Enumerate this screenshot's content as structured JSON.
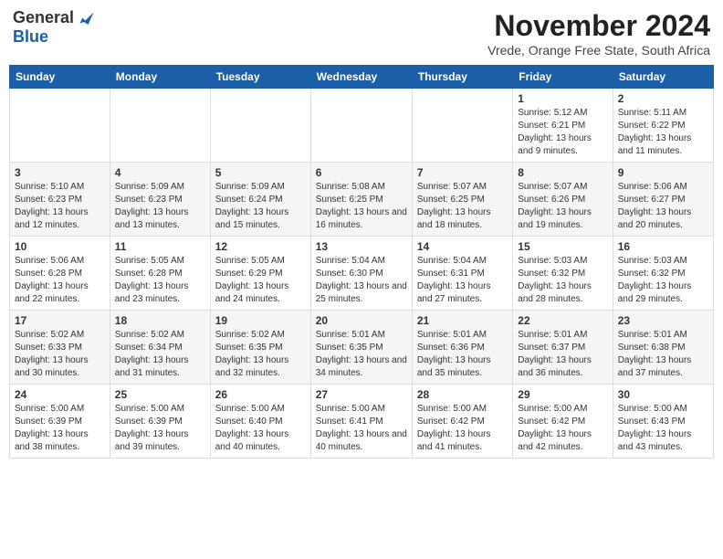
{
  "header": {
    "logo_general": "General",
    "logo_blue": "Blue",
    "month_title": "November 2024",
    "location": "Vrede, Orange Free State, South Africa"
  },
  "days_of_week": [
    "Sunday",
    "Monday",
    "Tuesday",
    "Wednesday",
    "Thursday",
    "Friday",
    "Saturday"
  ],
  "weeks": [
    [
      {
        "day": "",
        "info": ""
      },
      {
        "day": "",
        "info": ""
      },
      {
        "day": "",
        "info": ""
      },
      {
        "day": "",
        "info": ""
      },
      {
        "day": "",
        "info": ""
      },
      {
        "day": "1",
        "info": "Sunrise: 5:12 AM\nSunset: 6:21 PM\nDaylight: 13 hours and 9 minutes."
      },
      {
        "day": "2",
        "info": "Sunrise: 5:11 AM\nSunset: 6:22 PM\nDaylight: 13 hours and 11 minutes."
      }
    ],
    [
      {
        "day": "3",
        "info": "Sunrise: 5:10 AM\nSunset: 6:23 PM\nDaylight: 13 hours and 12 minutes."
      },
      {
        "day": "4",
        "info": "Sunrise: 5:09 AM\nSunset: 6:23 PM\nDaylight: 13 hours and 13 minutes."
      },
      {
        "day": "5",
        "info": "Sunrise: 5:09 AM\nSunset: 6:24 PM\nDaylight: 13 hours and 15 minutes."
      },
      {
        "day": "6",
        "info": "Sunrise: 5:08 AM\nSunset: 6:25 PM\nDaylight: 13 hours and 16 minutes."
      },
      {
        "day": "7",
        "info": "Sunrise: 5:07 AM\nSunset: 6:25 PM\nDaylight: 13 hours and 18 minutes."
      },
      {
        "day": "8",
        "info": "Sunrise: 5:07 AM\nSunset: 6:26 PM\nDaylight: 13 hours and 19 minutes."
      },
      {
        "day": "9",
        "info": "Sunrise: 5:06 AM\nSunset: 6:27 PM\nDaylight: 13 hours and 20 minutes."
      }
    ],
    [
      {
        "day": "10",
        "info": "Sunrise: 5:06 AM\nSunset: 6:28 PM\nDaylight: 13 hours and 22 minutes."
      },
      {
        "day": "11",
        "info": "Sunrise: 5:05 AM\nSunset: 6:28 PM\nDaylight: 13 hours and 23 minutes."
      },
      {
        "day": "12",
        "info": "Sunrise: 5:05 AM\nSunset: 6:29 PM\nDaylight: 13 hours and 24 minutes."
      },
      {
        "day": "13",
        "info": "Sunrise: 5:04 AM\nSunset: 6:30 PM\nDaylight: 13 hours and 25 minutes."
      },
      {
        "day": "14",
        "info": "Sunrise: 5:04 AM\nSunset: 6:31 PM\nDaylight: 13 hours and 27 minutes."
      },
      {
        "day": "15",
        "info": "Sunrise: 5:03 AM\nSunset: 6:32 PM\nDaylight: 13 hours and 28 minutes."
      },
      {
        "day": "16",
        "info": "Sunrise: 5:03 AM\nSunset: 6:32 PM\nDaylight: 13 hours and 29 minutes."
      }
    ],
    [
      {
        "day": "17",
        "info": "Sunrise: 5:02 AM\nSunset: 6:33 PM\nDaylight: 13 hours and 30 minutes."
      },
      {
        "day": "18",
        "info": "Sunrise: 5:02 AM\nSunset: 6:34 PM\nDaylight: 13 hours and 31 minutes."
      },
      {
        "day": "19",
        "info": "Sunrise: 5:02 AM\nSunset: 6:35 PM\nDaylight: 13 hours and 32 minutes."
      },
      {
        "day": "20",
        "info": "Sunrise: 5:01 AM\nSunset: 6:35 PM\nDaylight: 13 hours and 34 minutes."
      },
      {
        "day": "21",
        "info": "Sunrise: 5:01 AM\nSunset: 6:36 PM\nDaylight: 13 hours and 35 minutes."
      },
      {
        "day": "22",
        "info": "Sunrise: 5:01 AM\nSunset: 6:37 PM\nDaylight: 13 hours and 36 minutes."
      },
      {
        "day": "23",
        "info": "Sunrise: 5:01 AM\nSunset: 6:38 PM\nDaylight: 13 hours and 37 minutes."
      }
    ],
    [
      {
        "day": "24",
        "info": "Sunrise: 5:00 AM\nSunset: 6:39 PM\nDaylight: 13 hours and 38 minutes."
      },
      {
        "day": "25",
        "info": "Sunrise: 5:00 AM\nSunset: 6:39 PM\nDaylight: 13 hours and 39 minutes."
      },
      {
        "day": "26",
        "info": "Sunrise: 5:00 AM\nSunset: 6:40 PM\nDaylight: 13 hours and 40 minutes."
      },
      {
        "day": "27",
        "info": "Sunrise: 5:00 AM\nSunset: 6:41 PM\nDaylight: 13 hours and 40 minutes."
      },
      {
        "day": "28",
        "info": "Sunrise: 5:00 AM\nSunset: 6:42 PM\nDaylight: 13 hours and 41 minutes."
      },
      {
        "day": "29",
        "info": "Sunrise: 5:00 AM\nSunset: 6:42 PM\nDaylight: 13 hours and 42 minutes."
      },
      {
        "day": "30",
        "info": "Sunrise: 5:00 AM\nSunset: 6:43 PM\nDaylight: 13 hours and 43 minutes."
      }
    ]
  ]
}
